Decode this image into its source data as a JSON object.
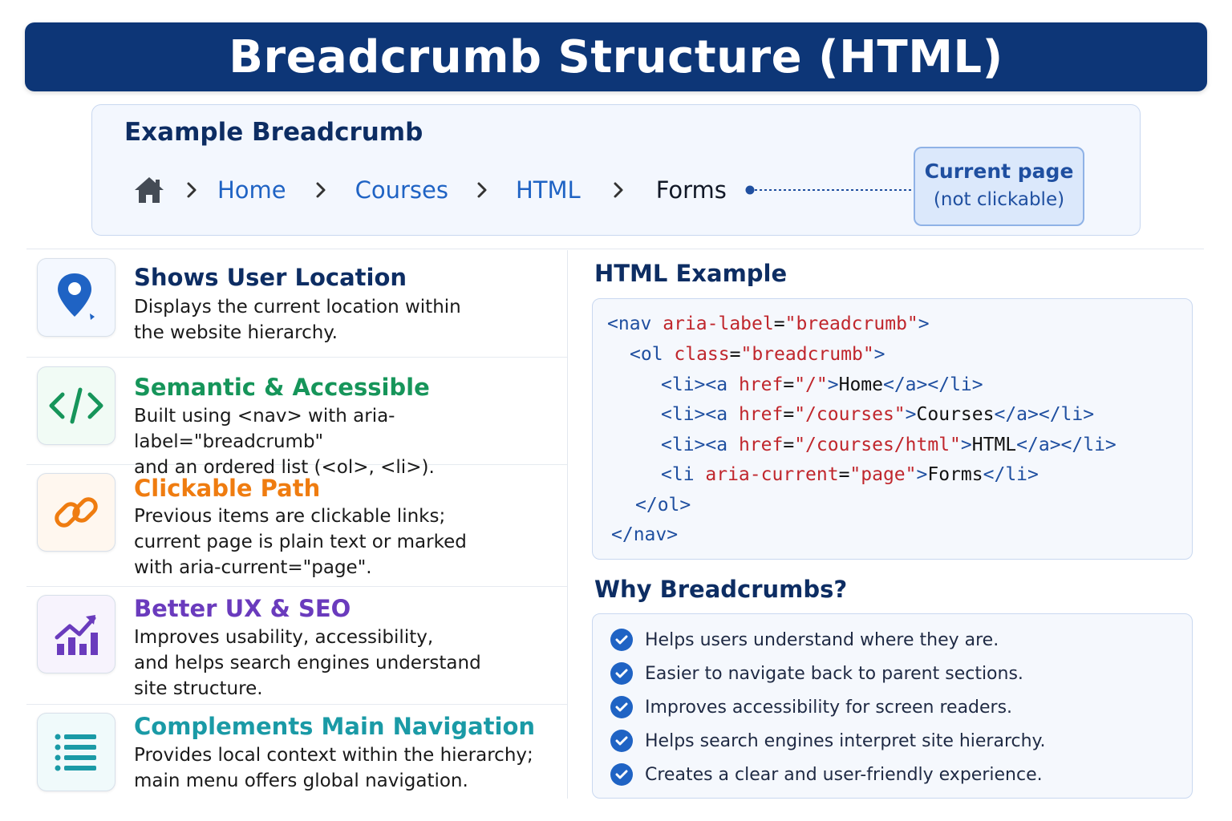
{
  "title": "Breadcrumb Structure (HTML)",
  "example": {
    "heading": "Example Breadcrumb",
    "crumbs": [
      "Home",
      "Courses",
      "HTML"
    ],
    "current": "Forms",
    "callout_line1": "Current page",
    "callout_line2": "(not clickable)"
  },
  "features": [
    {
      "title": "Shows User Location",
      "color": "#0d2d63",
      "icon": "location-pin-icon",
      "desc": [
        "Displays the current location within",
        "the website hierarchy."
      ]
    },
    {
      "title": "Semantic & Accessible",
      "color": "#16955a",
      "icon": "code-icon",
      "desc": [
        "Built using <nav> with aria-label=\"breadcrumb\"",
        "and an ordered list (<ol>, <li>)."
      ]
    },
    {
      "title": "Clickable Path",
      "color": "#ef7c10",
      "icon": "link-icon",
      "desc": [
        "Previous items are clickable links;",
        "current page is plain text or marked",
        "with aria-current=\"page\"."
      ]
    },
    {
      "title": "Better UX & SEO",
      "color": "#6a3bbd",
      "icon": "trending-chart-icon",
      "desc": [
        "Improves usability, accessibility,",
        "and helps search engines understand",
        "site structure."
      ]
    },
    {
      "title": "Complements Main Navigation",
      "color": "#1a9aa6",
      "icon": "list-icon",
      "desc": [
        "Provides local context within the hierarchy;",
        "main menu offers global navigation."
      ]
    }
  ],
  "html_example": {
    "heading": "HTML Example",
    "lines": [
      [
        [
          "tg",
          "<nav "
        ],
        [
          "at",
          "aria-label"
        ],
        [
          "tx",
          "="
        ],
        [
          "vl",
          "\"breadcrumb\""
        ],
        [
          "tg",
          ">"
        ]
      ],
      [
        [
          "tg",
          "<ol "
        ],
        [
          "at",
          "class"
        ],
        [
          "tx",
          "="
        ],
        [
          "vl",
          "\"breadcrumb\""
        ],
        [
          "tg",
          ">"
        ]
      ],
      [
        [
          "tg",
          "<li><a "
        ],
        [
          "at",
          "href"
        ],
        [
          "tx",
          "="
        ],
        [
          "vl",
          "\"/\""
        ],
        [
          "tg",
          ">"
        ],
        [
          "tx",
          "Home"
        ],
        [
          "tg",
          "</a></li>"
        ]
      ],
      [
        [
          "tg",
          "<li><a "
        ],
        [
          "at",
          "href"
        ],
        [
          "tx",
          "="
        ],
        [
          "vl",
          "\"/courses\""
        ],
        [
          "tg",
          ">"
        ],
        [
          "tx",
          "Courses"
        ],
        [
          "tg",
          "</a></li>"
        ]
      ],
      [
        [
          "tg",
          "<li><a "
        ],
        [
          "at",
          "href"
        ],
        [
          "tx",
          "="
        ],
        [
          "vl",
          "\"/courses/html\""
        ],
        [
          "tg",
          ">"
        ],
        [
          "tx",
          "HTML"
        ],
        [
          "tg",
          "</a></li>"
        ]
      ],
      [
        [
          "tg",
          "<li "
        ],
        [
          "at",
          "aria-current"
        ],
        [
          "tx",
          "="
        ],
        [
          "vl",
          "\"page\""
        ],
        [
          "tg",
          ">"
        ],
        [
          "tx",
          "Forms"
        ],
        [
          "tg",
          "</li>"
        ]
      ],
      [
        [
          "tg",
          "</ol>"
        ]
      ],
      [
        [
          "tg",
          "</nav>"
        ]
      ]
    ]
  },
  "why": {
    "heading": "Why Breadcrumbs?",
    "items": [
      "Helps users understand where they are.",
      "Easier to navigate back to parent sections.",
      "Improves accessibility for screen readers.",
      "Helps search engines interpret site hierarchy.",
      "Creates a clear and user-friendly experience."
    ]
  }
}
